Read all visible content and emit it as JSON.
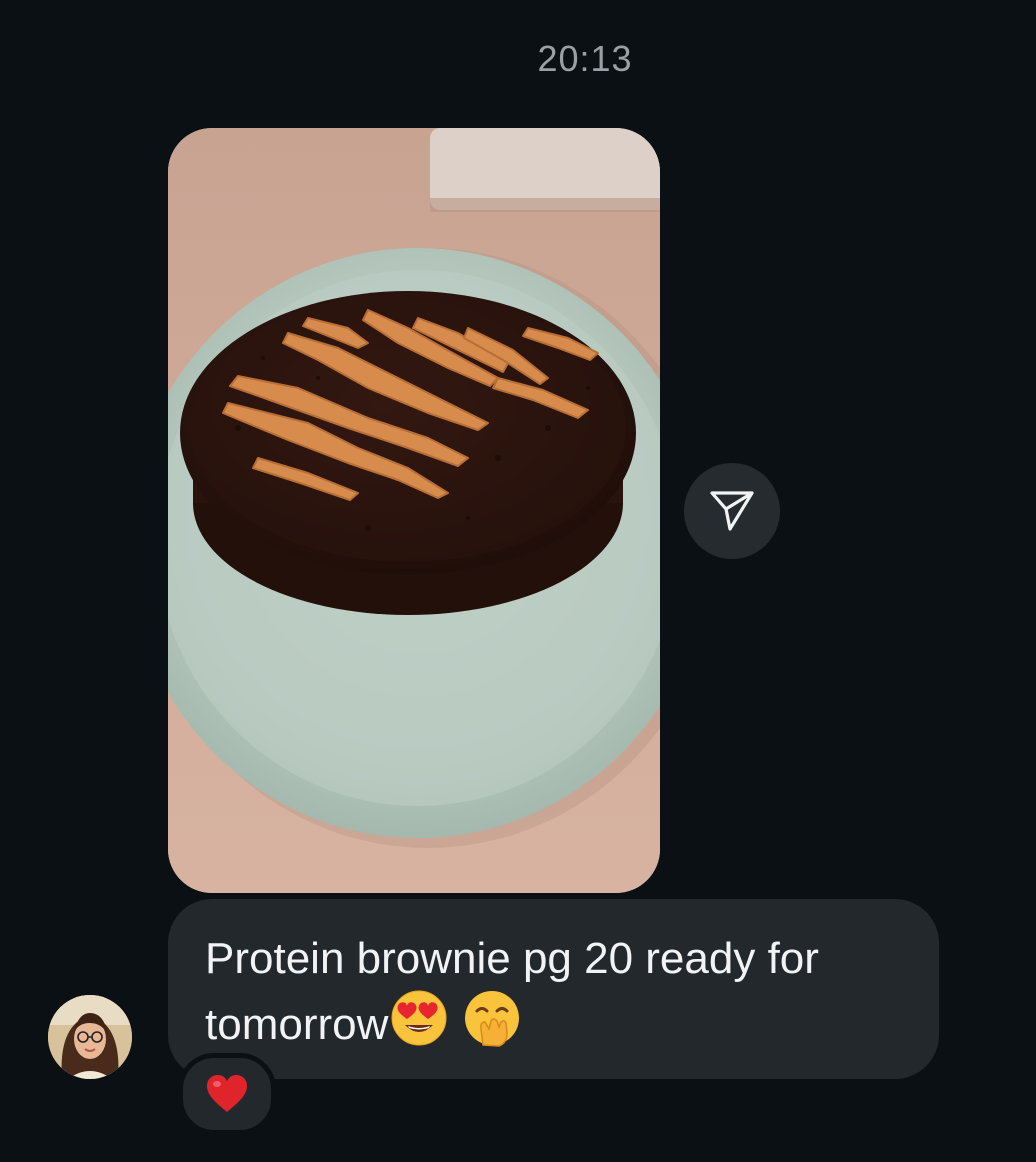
{
  "conversation": {
    "timestamp": "20:13",
    "photo_message": {
      "image_subject": "protein-brownie-on-plate",
      "share_icon": "paper-plane-icon"
    },
    "text_message": {
      "text": "Protein brownie pg 20 ready for tomorrow",
      "emojis": [
        "heart-eyes-emoji",
        "hand-over-mouth-emoji"
      ]
    },
    "sender_avatar": "avatar",
    "reaction": {
      "emoji": "heart-emoji",
      "color": "#e0242c"
    }
  },
  "colors": {
    "background": "#0b1014",
    "bubble": "#23282d",
    "share_button": "#262b30",
    "timestamp": "#9aa0a6",
    "text": "#f1f3f4"
  }
}
